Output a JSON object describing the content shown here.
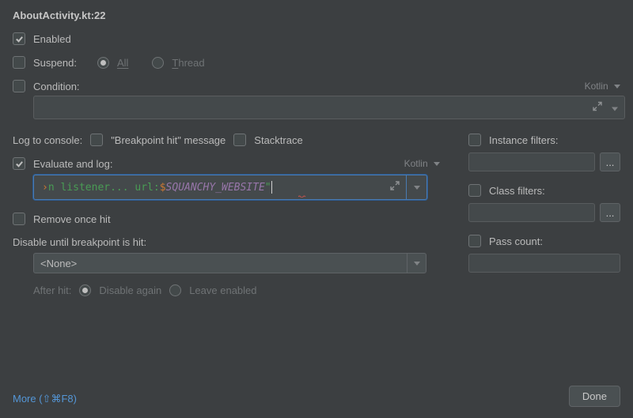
{
  "title": "AboutActivity.kt:22",
  "enabled": {
    "label": "Enabled",
    "checked": true
  },
  "suspend": {
    "label": "Suspend:",
    "checked": false,
    "options": {
      "all": "All",
      "thread": "Thread"
    },
    "selected": "all"
  },
  "condition": {
    "label": "Condition:",
    "checked": false,
    "language": "Kotlin",
    "value": ""
  },
  "log_to_console": {
    "label": "Log to console:",
    "breakpoint_hit": {
      "label": "\"Breakpoint hit\" message",
      "checked": false
    },
    "stacktrace": {
      "label": "Stacktrace",
      "checked": false
    }
  },
  "evaluate_and_log": {
    "label": "Evaluate and log:",
    "checked": true,
    "language": "Kotlin",
    "expression_visible": {
      "prefix_plain": "n listener... url: ",
      "dollar": "$",
      "const": "SQUANCHY_WEBSITE",
      "end_quote": "\""
    }
  },
  "remove_once_hit": {
    "label": "Remove once hit",
    "checked": false
  },
  "disable_until": {
    "label": "Disable until breakpoint is hit:",
    "value": "<None>"
  },
  "after_hit": {
    "label": "After hit:",
    "options": {
      "disable_again": "Disable again",
      "leave_enabled": "Leave enabled"
    },
    "selected": "disable_again"
  },
  "right": {
    "instance_filters": {
      "label": "Instance filters:",
      "checked": false,
      "value": ""
    },
    "class_filters": {
      "label": "Class filters:",
      "checked": false,
      "value": ""
    },
    "pass_count": {
      "label": "Pass count:",
      "checked": false,
      "value": ""
    }
  },
  "buttons": {
    "done": "Done",
    "more": "More (⇧⌘F8)",
    "ellipsis": "..."
  }
}
